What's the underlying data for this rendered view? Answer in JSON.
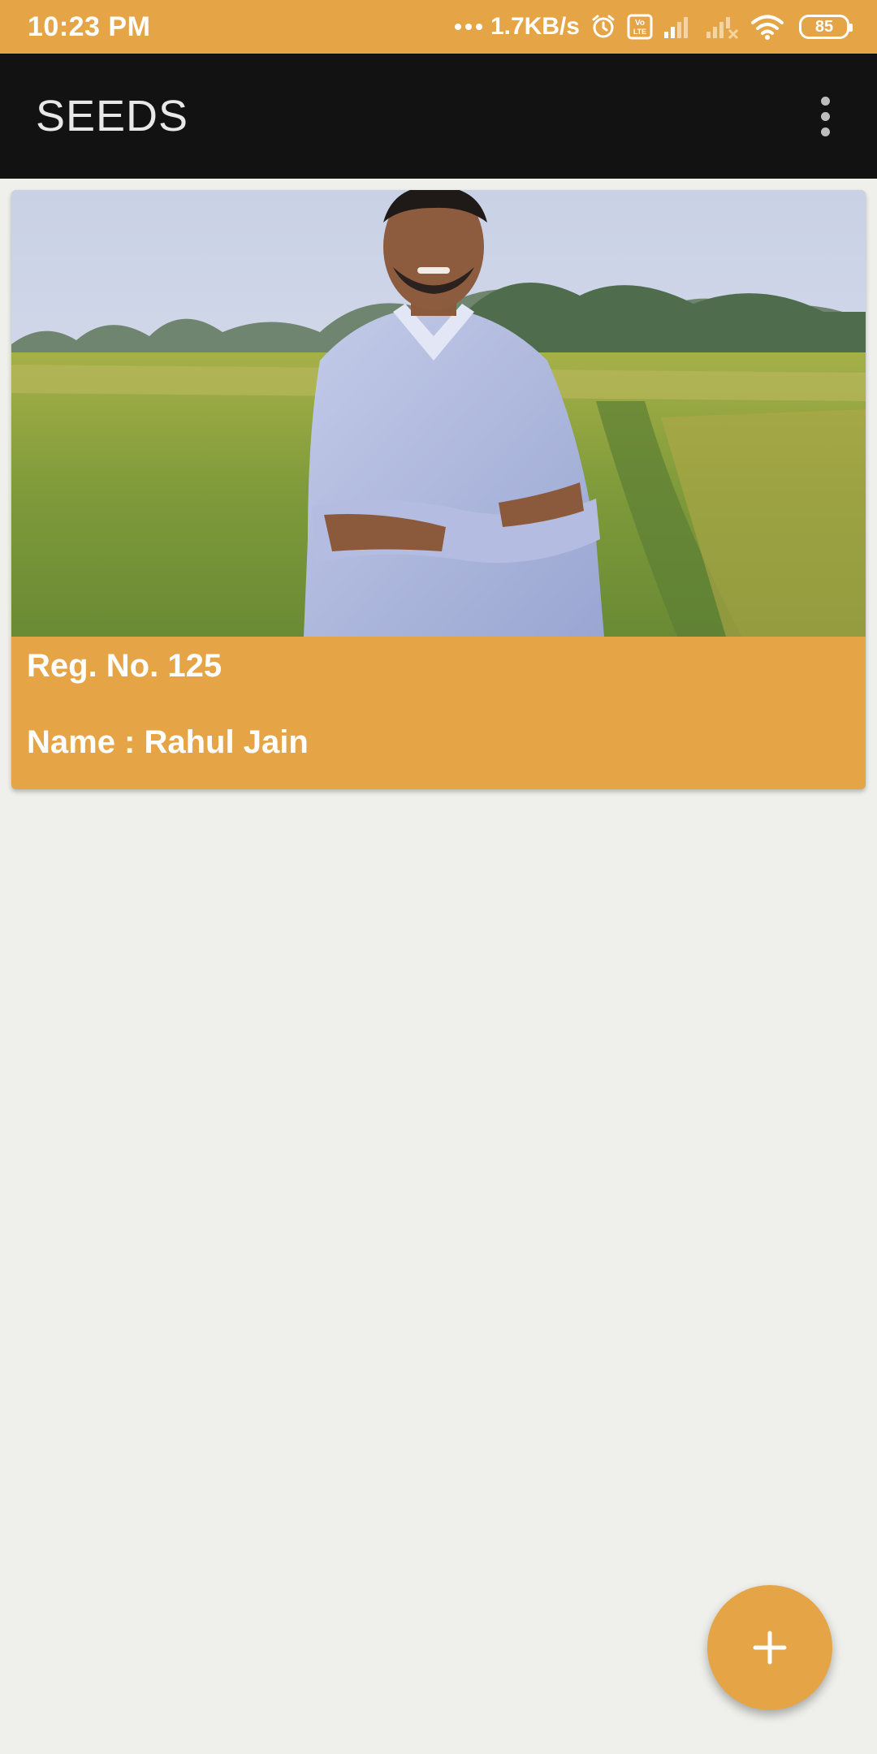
{
  "status_bar": {
    "time": "10:23 PM",
    "net_speed": "1.7KB/s",
    "volte": "Vo\nLTE",
    "battery": "85"
  },
  "app_bar": {
    "title": "SEEDS",
    "overflow_icon": "more-vert-icon"
  },
  "cards": [
    {
      "photo": "man-in-field-photo",
      "reg_no": "Reg. No. 125",
      "name": "Name : Rahul Jain"
    }
  ],
  "fab": {
    "icon": "plus-icon"
  },
  "colors": {
    "accent": "#e5a445",
    "app_bar": "#121212",
    "background": "#efefeb"
  }
}
